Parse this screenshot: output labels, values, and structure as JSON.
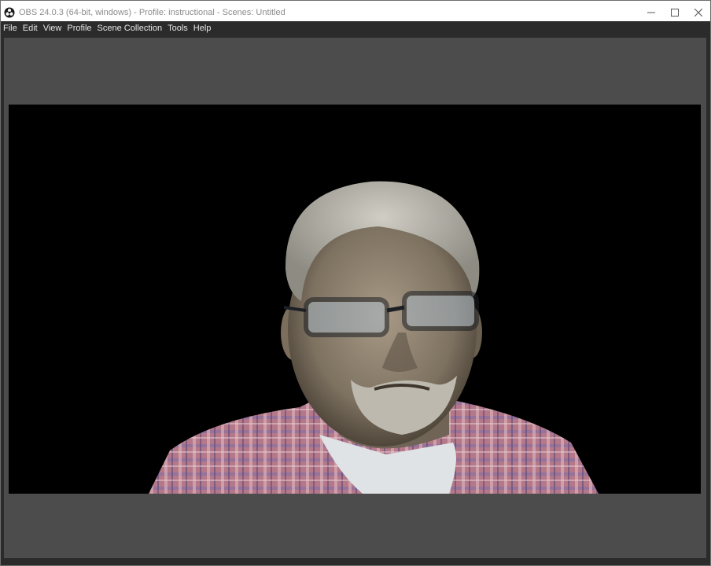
{
  "window": {
    "title": "OBS 24.0.3 (64-bit, windows) - Profile: instructional - Scenes: Untitled"
  },
  "menu": {
    "items": [
      "File",
      "Edit",
      "View",
      "Profile",
      "Scene Collection",
      "Tools",
      "Help"
    ]
  },
  "icons": {
    "app": "obs-logo-icon",
    "minimize": "minimize-icon",
    "maximize": "maximize-icon",
    "close": "close-icon"
  },
  "colors": {
    "menubar_bg": "#2b2b2b",
    "preview_bg": "#4c4c4c",
    "canvas_bg": "#000000"
  }
}
